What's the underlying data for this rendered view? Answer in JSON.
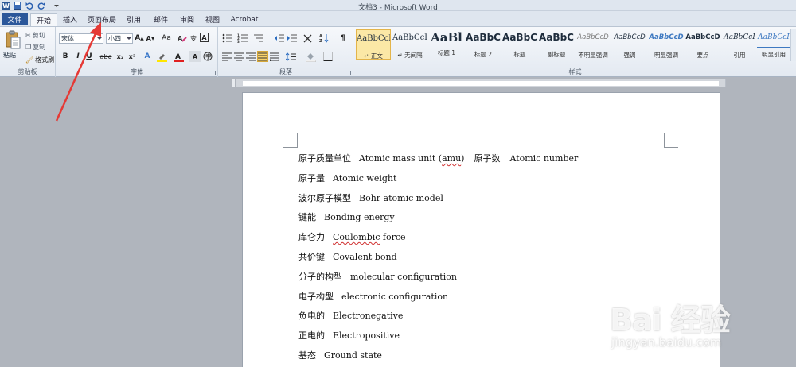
{
  "window": {
    "title": "文档3 - Microsoft Word"
  },
  "tabs": [
    {
      "label": "文件"
    },
    {
      "label": "开始"
    },
    {
      "label": "插入"
    },
    {
      "label": "页面布局"
    },
    {
      "label": "引用"
    },
    {
      "label": "邮件"
    },
    {
      "label": "审阅"
    },
    {
      "label": "视图"
    },
    {
      "label": "Acrobat"
    }
  ],
  "clipboard": {
    "paste": "粘贴",
    "cut": "剪切",
    "copy": "复制",
    "format_painter": "格式刷",
    "label": "剪贴板"
  },
  "font": {
    "family": "宋体",
    "size": "小四",
    "label": "字体",
    "bold": "B",
    "italic": "I",
    "underline": "U",
    "grow": "A",
    "shrink": "A",
    "case": "Aa",
    "strike": "abe",
    "sub": "x₂",
    "sup": "x²"
  },
  "paragraph": {
    "label": "段落"
  },
  "styles": {
    "label": "样式",
    "items": [
      {
        "sample": "AaBbCcI",
        "name": "↵ 正文"
      },
      {
        "sample": "AaBbCcI",
        "name": "↵ 无间隔"
      },
      {
        "sample": "AaBl",
        "name": "标题 1"
      },
      {
        "sample": "AaBbC",
        "name": "标题 2"
      },
      {
        "sample": "AaBbC",
        "name": "标题"
      },
      {
        "sample": "AaBbC",
        "name": "副标题"
      },
      {
        "sample": "AaBbCcD",
        "name": "不明显强调"
      },
      {
        "sample": "AaBbCcD",
        "name": "强调"
      },
      {
        "sample": "AaBbCcD",
        "name": "明显强调"
      },
      {
        "sample": "AaBbCcD",
        "name": "要点"
      },
      {
        "sample": "AaBbCcI",
        "name": "引用"
      },
      {
        "sample": "AaBbCcI",
        "name": "明显引用"
      }
    ]
  },
  "document": {
    "lines": [
      {
        "zh": "原子质量单位",
        "en": "Atomic mass unit (amu)",
        "extra_zh": "原子数",
        "extra_en": "Atomic number"
      },
      {
        "zh": "原子量",
        "en": "Atomic weight"
      },
      {
        "zh": "波尔原子模型",
        "en": "Bohr atomic model"
      },
      {
        "zh": "键能",
        "en": "Bonding energy"
      },
      {
        "zh": "库仑力",
        "en": "Coulombic force"
      },
      {
        "zh": "共价键",
        "en": "Covalent bond"
      },
      {
        "zh": "分子的构型",
        "en": "molecular configuration"
      },
      {
        "zh": "电子构型",
        "en": "electronic configuration"
      },
      {
        "zh": "负电的",
        "en": "Electronegative"
      },
      {
        "zh": "正电的",
        "en": "Electropositive"
      },
      {
        "zh": "基态",
        "en": "Ground state"
      }
    ]
  },
  "watermark": {
    "main": "Bai 经验",
    "sub": "jingyan.baidu.com"
  },
  "colors": {
    "file_tab": "#2b579a",
    "annotation": "#e53935",
    "selected_style": "#fbe8a6"
  }
}
